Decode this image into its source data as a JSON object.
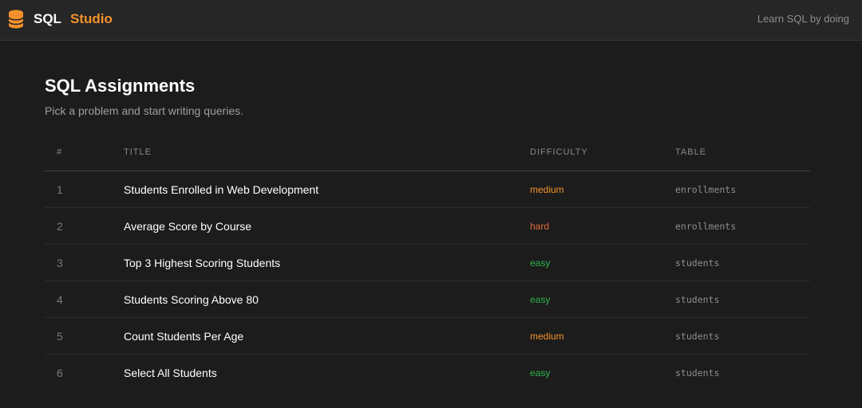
{
  "header": {
    "brand_primary": "SQL",
    "brand_accent": "Studio",
    "tagline": "Learn SQL by doing",
    "logo_icon": "database-icon",
    "accent_color": "#f5922b"
  },
  "page": {
    "title": "SQL Assignments",
    "subtitle": "Pick a problem and start writing queries."
  },
  "table": {
    "columns": [
      "#",
      "TITLE",
      "DIFFICULTY",
      "TABLE"
    ],
    "rows": [
      {
        "num": "1",
        "title": "Students Enrolled in Web Development",
        "difficulty": "medium",
        "table": "enrollments"
      },
      {
        "num": "2",
        "title": "Average Score by Course",
        "difficulty": "hard",
        "table": "enrollments"
      },
      {
        "num": "3",
        "title": "Top 3 Highest Scoring Students",
        "difficulty": "easy",
        "table": "students"
      },
      {
        "num": "4",
        "title": "Students Scoring Above 80",
        "difficulty": "easy",
        "table": "students"
      },
      {
        "num": "5",
        "title": "Count Students Per Age",
        "difficulty": "medium",
        "table": "students"
      },
      {
        "num": "6",
        "title": "Select All Students",
        "difficulty": "easy",
        "table": "students"
      }
    ]
  },
  "difficulty_colors": {
    "easy": "#2fb34e",
    "medium": "#f5922b",
    "hard": "#e06a3b"
  }
}
